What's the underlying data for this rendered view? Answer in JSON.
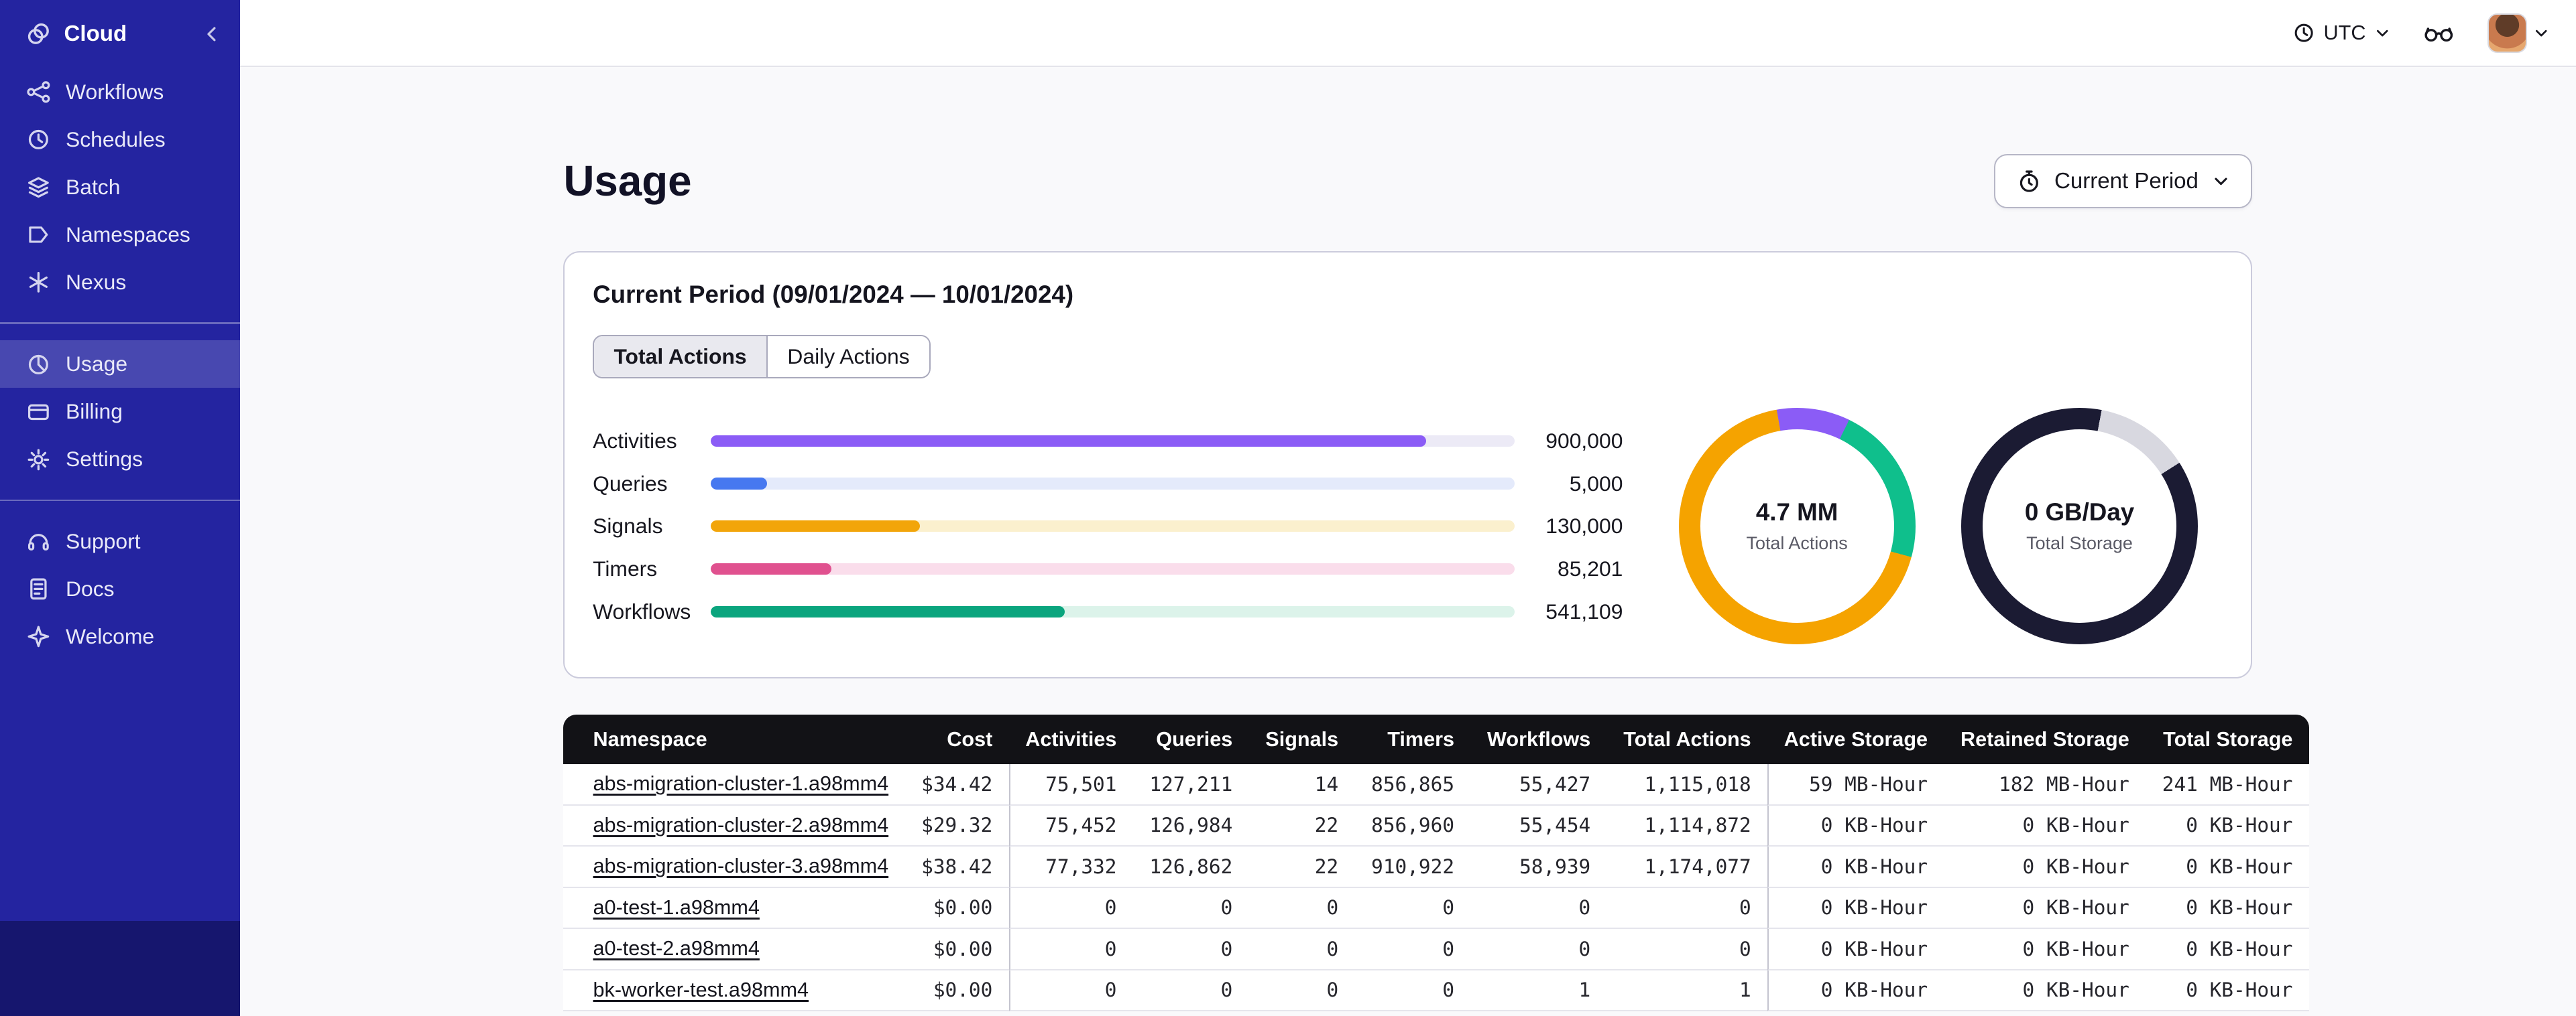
{
  "sidebar": {
    "logo_label": "Cloud",
    "sections": [
      {
        "items": [
          {
            "label": "Workflows",
            "icon": "workflows-icon"
          },
          {
            "label": "Schedules",
            "icon": "schedules-icon"
          },
          {
            "label": "Batch",
            "icon": "batch-icon"
          },
          {
            "label": "Namespaces",
            "icon": "namespaces-icon"
          },
          {
            "label": "Nexus",
            "icon": "nexus-icon"
          }
        ]
      },
      {
        "items": [
          {
            "label": "Usage",
            "icon": "usage-icon",
            "active": true
          },
          {
            "label": "Billing",
            "icon": "billing-icon"
          },
          {
            "label": "Settings",
            "icon": "settings-icon"
          }
        ]
      },
      {
        "items": [
          {
            "label": "Support",
            "icon": "support-icon"
          },
          {
            "label": "Docs",
            "icon": "docs-icon"
          },
          {
            "label": "Welcome",
            "icon": "welcome-icon"
          }
        ]
      }
    ]
  },
  "topbar": {
    "timezone": "UTC"
  },
  "page": {
    "title": "Usage",
    "period_button_label": "Current Period"
  },
  "usage_card": {
    "title": "Current Period (09/01/2024 — 10/01/2024)",
    "tabs": [
      {
        "label": "Total Actions",
        "active": true
      },
      {
        "label": "Daily Actions",
        "active": false
      }
    ]
  },
  "bars": {
    "rows": [
      {
        "label": "Activities",
        "value": "900,000",
        "pct": "89%",
        "color": "#8B5CF6",
        "track": "#ECEAF6"
      },
      {
        "label": "Queries",
        "value": "5,000",
        "pct": "7%",
        "color": "#4678F0",
        "track": "#E4EAFB"
      },
      {
        "label": "Signals",
        "value": "130,000",
        "pct": "26%",
        "color": "#F2A50A",
        "track": "#FBF0CE"
      },
      {
        "label": "Timers",
        "value": "85,201",
        "pct": "15%",
        "color": "#E0518F",
        "track": "#FADDEB"
      },
      {
        "label": "Workflows",
        "value": "541,109",
        "pct": "44%",
        "color": "#0BA57E",
        "track": "#DCF3EA"
      }
    ]
  },
  "donuts": [
    {
      "value": "4.7 MM",
      "caption": "Total Actions",
      "from": "-10deg",
      "segments": [
        {
          "color": "#8B5CF6",
          "pct": 10
        },
        {
          "color": "#0FBF8C",
          "pct": 22
        },
        {
          "color": "#F5A300",
          "pct": 68
        }
      ]
    },
    {
      "value": "0 GB/Day",
      "caption": "Total Storage",
      "from": "0deg",
      "segments": [
        {
          "color": "#1B1B33",
          "pct": 3
        },
        {
          "color": "#D8D8E0",
          "pct": 13
        },
        {
          "color": "#1B1B33",
          "pct": 84
        }
      ]
    }
  ],
  "table": {
    "headers": [
      "Namespace",
      "Cost",
      "Activities",
      "Queries",
      "Signals",
      "Timers",
      "Workflows",
      "Total Actions",
      "Active Storage",
      "Retained Storage",
      "Total Storage"
    ],
    "rows": [
      {
        "namespace": "abs-migration-cluster-1.a98mm4",
        "cost": "$34.42",
        "activities": "75,501",
        "queries": "127,211",
        "signals": "14",
        "timers": "856,865",
        "workflows": "55,427",
        "total_actions": "1,115,018",
        "active_storage": "59 MB-Hour",
        "retained_storage": "182 MB-Hour",
        "total_storage": "241 MB-Hour"
      },
      {
        "namespace": "abs-migration-cluster-2.a98mm4",
        "cost": "$29.32",
        "activities": "75,452",
        "queries": "126,984",
        "signals": "22",
        "timers": "856,960",
        "workflows": "55,454",
        "total_actions": "1,114,872",
        "active_storage": "0 KB-Hour",
        "retained_storage": "0 KB-Hour",
        "total_storage": "0 KB-Hour"
      },
      {
        "namespace": "abs-migration-cluster-3.a98mm4",
        "cost": "$38.42",
        "activities": "77,332",
        "queries": "126,862",
        "signals": "22",
        "timers": "910,922",
        "workflows": "58,939",
        "total_actions": "1,174,077",
        "active_storage": "0 KB-Hour",
        "retained_storage": "0 KB-Hour",
        "total_storage": "0 KB-Hour"
      },
      {
        "namespace": "a0-test-1.a98mm4",
        "cost": "$0.00",
        "activities": "0",
        "queries": "0",
        "signals": "0",
        "timers": "0",
        "workflows": "0",
        "total_actions": "0",
        "active_storage": "0 KB-Hour",
        "retained_storage": "0 KB-Hour",
        "total_storage": "0 KB-Hour"
      },
      {
        "namespace": "a0-test-2.a98mm4",
        "cost": "$0.00",
        "activities": "0",
        "queries": "0",
        "signals": "0",
        "timers": "0",
        "workflows": "0",
        "total_actions": "0",
        "active_storage": "0 KB-Hour",
        "retained_storage": "0 KB-Hour",
        "total_storage": "0 KB-Hour"
      },
      {
        "namespace": "bk-worker-test.a98mm4",
        "cost": "$0.00",
        "activities": "0",
        "queries": "0",
        "signals": "0",
        "timers": "0",
        "workflows": "1",
        "total_actions": "1",
        "active_storage": "0 KB-Hour",
        "retained_storage": "0 KB-Hour",
        "total_storage": "0 KB-Hour"
      }
    ]
  },
  "chart_data": [
    {
      "type": "bar",
      "orientation": "horizontal",
      "title": "Current Period (09/01/2024 — 10/01/2024) — Total Actions",
      "categories": [
        "Activities",
        "Queries",
        "Signals",
        "Timers",
        "Workflows"
      ],
      "values": [
        900000,
        5000,
        130000,
        85201,
        541109
      ],
      "value_labels": [
        "900,000",
        "5,000",
        "130,000",
        "85,201",
        "541,109"
      ],
      "colors": [
        "#8B5CF6",
        "#4678F0",
        "#F2A50A",
        "#E0518F",
        "#0BA57E"
      ]
    },
    {
      "type": "pie",
      "title": "Total Actions",
      "center_label": "4.7 MM",
      "values": [
        10,
        22,
        68
      ],
      "colors": [
        "#8B5CF6",
        "#0FBF8C",
        "#F5A300"
      ],
      "note": "segment sizes in percent, estimated from arc angles"
    },
    {
      "type": "pie",
      "title": "Total Storage",
      "center_label": "0 GB/Day",
      "values": [
        16,
        84
      ],
      "colors": [
        "#D8D8E0",
        "#1B1B33"
      ],
      "note": "segment sizes in percent, estimated from arc angles"
    }
  ]
}
